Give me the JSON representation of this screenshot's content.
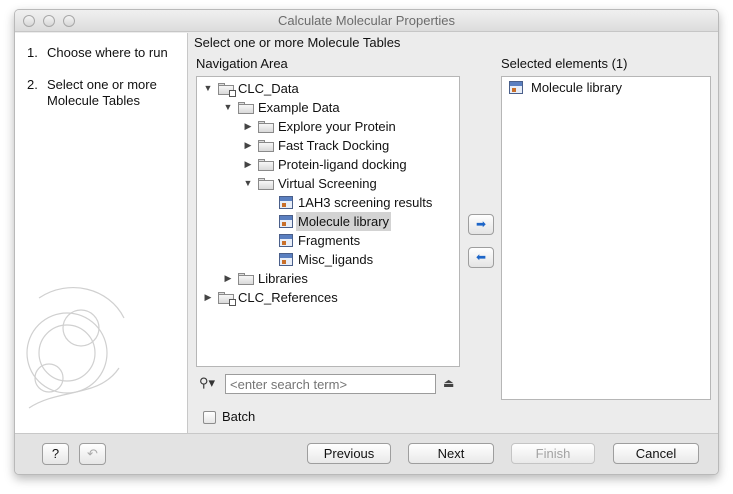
{
  "window": {
    "title": "Calculate Molecular Properties"
  },
  "steps": [
    {
      "number": "1.",
      "label": "Choose where to run"
    },
    {
      "number": "2.",
      "label": "Select one or more Molecule Tables"
    }
  ],
  "main": {
    "instruction": "Select one or more Molecule Tables",
    "navigation_heading": "Navigation Area",
    "selected_heading": "Selected elements (1)"
  },
  "tree": [
    {
      "label": "CLC_Data",
      "expanded": true,
      "icon": "server-folder-icon"
    },
    {
      "label": "Example Data",
      "expanded": true,
      "icon": "folder-icon"
    },
    {
      "label": "Explore your Protein",
      "expanded": false,
      "icon": "folder-icon"
    },
    {
      "label": "Fast Track Docking",
      "expanded": false,
      "icon": "folder-icon"
    },
    {
      "label": "Protein-ligand docking",
      "expanded": false,
      "icon": "folder-icon"
    },
    {
      "label": "Virtual Screening",
      "expanded": true,
      "icon": "folder-icon"
    },
    {
      "label": "1AH3 screening results",
      "icon": "molecule-table-icon"
    },
    {
      "label": "Molecule library",
      "icon": "molecule-table-icon",
      "selected": true
    },
    {
      "label": "Fragments",
      "icon": "molecule-table-icon"
    },
    {
      "label": "Misc_ligands",
      "icon": "molecule-table-icon"
    },
    {
      "label": "Libraries",
      "expanded": false,
      "icon": "folder-icon"
    },
    {
      "label": "CLC_References",
      "expanded": false,
      "icon": "server-folder-icon"
    }
  ],
  "selected_elements": [
    {
      "label": "Molecule library",
      "icon": "molecule-table-icon"
    }
  ],
  "search": {
    "placeholder": "<enter search term>",
    "value": ""
  },
  "batch": {
    "label": "Batch",
    "checked": false
  },
  "footer": {
    "help_label": "?",
    "previous_label": "Previous",
    "next_label": "Next",
    "finish_label": "Finish",
    "cancel_label": "Cancel"
  },
  "colors": {
    "accent": "#1e66c8",
    "selection": "#d3d3d3"
  }
}
